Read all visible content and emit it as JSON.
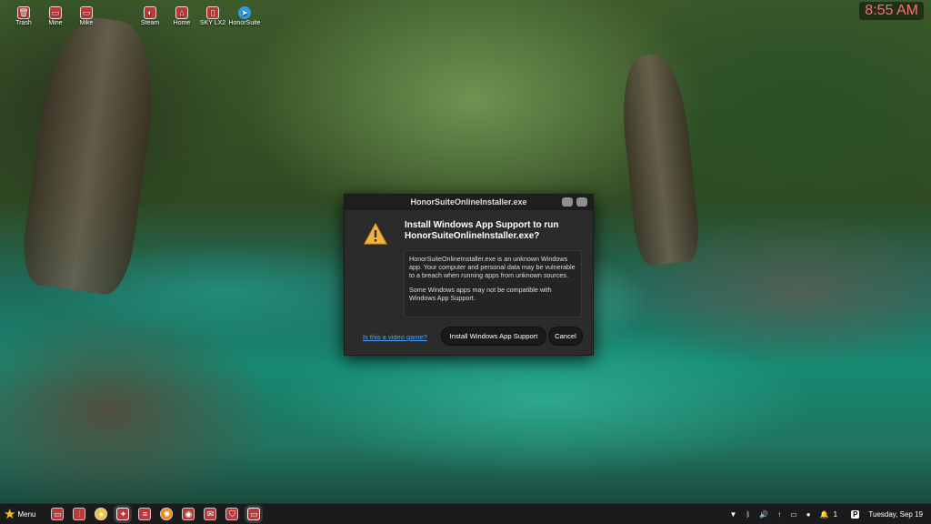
{
  "desktop": {
    "icons": [
      {
        "label": "Trash",
        "icon": "trash-icon"
      },
      {
        "label": "Mine",
        "icon": "folder-icon"
      },
      {
        "label": "Mike",
        "icon": "folder-icon"
      },
      {
        "label": "Steam",
        "icon": "steam-icon"
      },
      {
        "label": "Home",
        "icon": "home-icon"
      },
      {
        "label": "SKY LX2",
        "icon": "phone-icon"
      },
      {
        "label": "HonorSuite",
        "icon": "honorsuite-icon"
      }
    ]
  },
  "clock": {
    "time": "8:55 AM"
  },
  "dialog": {
    "title": "HonorSuiteOnlineInstaller.exe",
    "headline": "Install Windows App Support to run HonorSuiteOnlineInstaller.exe?",
    "message_1": "HonorSuiteOnlineInstaller.exe is an unknown Windows app. Your computer and personal data may be vulnerable to a breach when running apps from unknown sources.",
    "message_2": "Some Windows apps may not be compatible with Windows App Support.",
    "link": "Is this a video game?",
    "install_label": "Install Windows App Support",
    "cancel_label": "Cancel"
  },
  "taskbar": {
    "menu_label": "Menu",
    "tray_notifications": "1",
    "date": "Tuesday, Sep 19"
  },
  "colors": {
    "accent_link": "#4da3ff",
    "clock": "#ff6f6f",
    "app_icon": "#b93a3a"
  }
}
